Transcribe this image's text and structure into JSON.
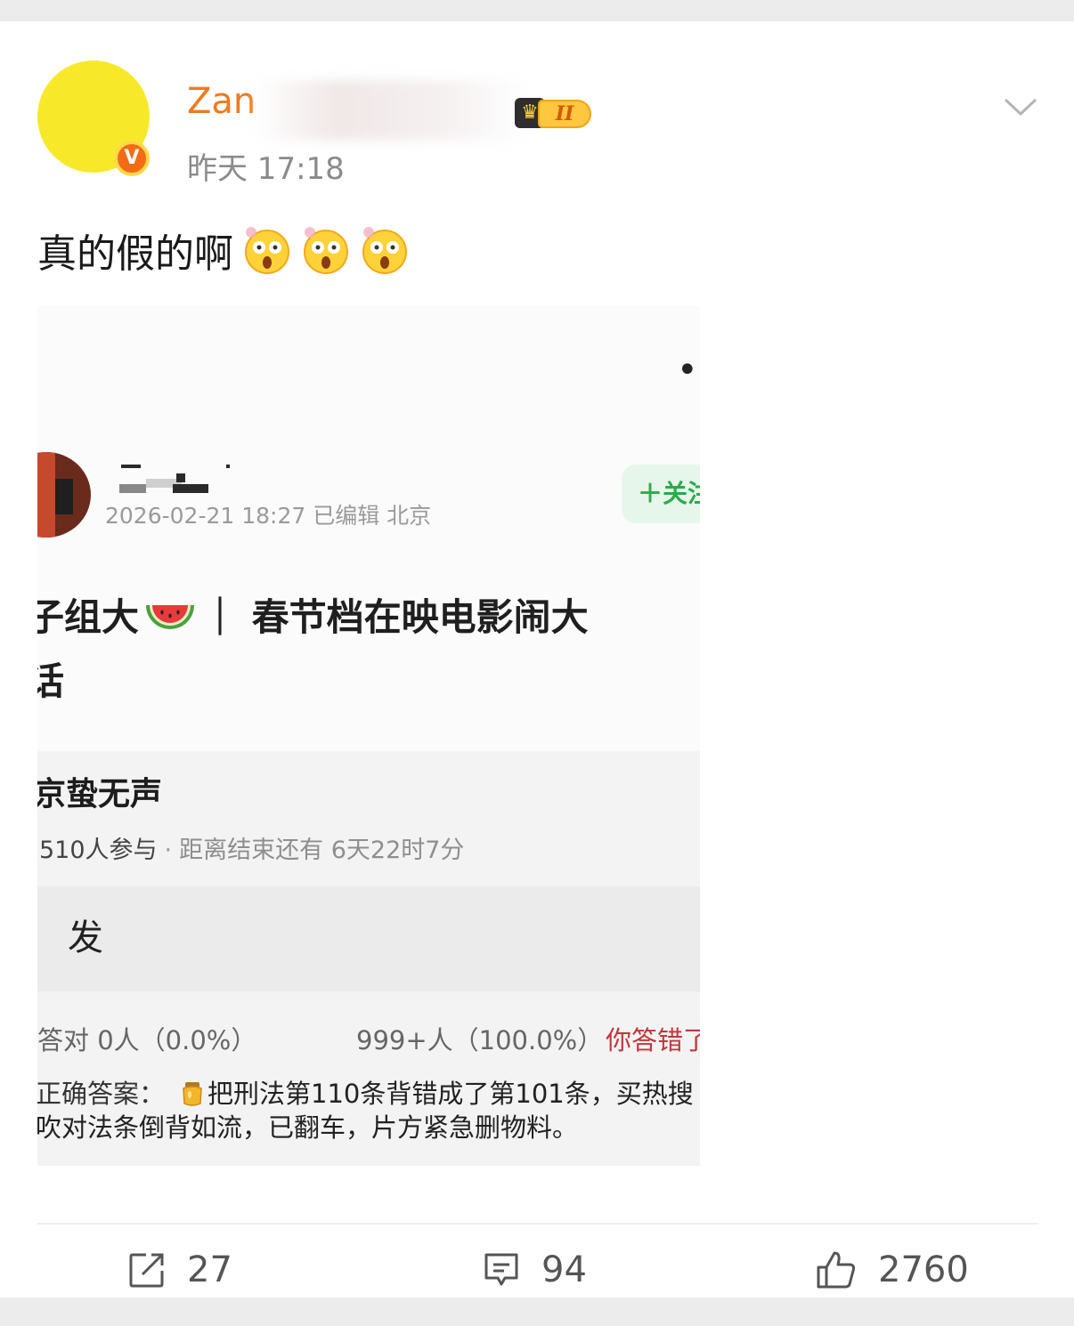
{
  "post": {
    "author_name_visible": "Zan",
    "level_badge": "II",
    "verified_badge": "V",
    "timestamp": "昨天 17:18",
    "text": "真的假的啊"
  },
  "embedded": {
    "more": "••",
    "meta": "2026-02-21 18:27 已编辑 北京",
    "follow_label": "＋关注",
    "title_line1_a": "子组大",
    "title_line1_b": "｜ 春节档在映电影闹大",
    "title_line2": "话",
    "quiz": {
      "title": "京蛰无声",
      "participants": "510人参与",
      "remaining": "距离结束还有 6天22时7分",
      "option_label": "发",
      "correct_result": "答对  0人（0.0%）",
      "wrong_count": "999+人（100.0%）",
      "wrong_tag": "你答错了",
      "answer_label": "正确答案：",
      "answer_line1": "把刑法第110条背错成了第101条，买热搜",
      "answer_line2": "吹对法条倒背如流，已翻车，片方紧急删物料。"
    }
  },
  "actions": {
    "repost_count": "27",
    "comment_count": "94",
    "like_count": "2760"
  },
  "colors": {
    "avatar": "#f7e92a",
    "username": "#f07a1d",
    "verified": "#f36b14",
    "follow_text": "#2eaa4d",
    "wrong_tag": "#c2353d"
  }
}
